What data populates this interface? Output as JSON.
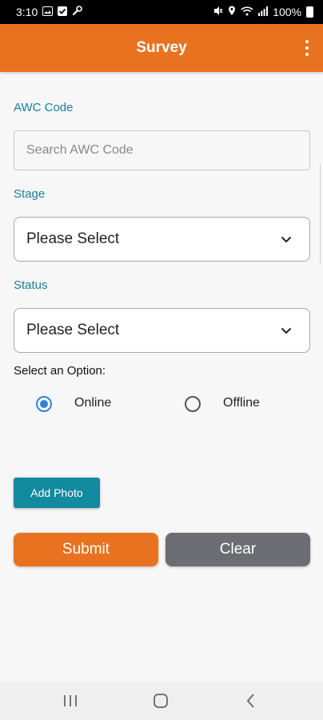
{
  "status_bar": {
    "time": "3:10",
    "battery": "100%",
    "icons": [
      "gallery-icon",
      "checkbox-icon",
      "wrench-icon",
      "mute-icon",
      "location-icon",
      "wifi-icon",
      "signal-icon",
      "battery-icon"
    ]
  },
  "app_bar": {
    "title": "Survey",
    "menu_icon": "more-vert-icon"
  },
  "form": {
    "awc_code": {
      "label": "AWC Code",
      "placeholder": "Search AWC Code",
      "value": ""
    },
    "stage": {
      "label": "Stage",
      "value": "Please Select"
    },
    "status": {
      "label": "Status",
      "value": "Please Select"
    },
    "option": {
      "label": "Select an Option:",
      "choices": [
        "Online",
        "Offline"
      ],
      "selected": "Online"
    },
    "add_photo_label": "Add Photo",
    "submit_label": "Submit",
    "clear_label": "Clear"
  },
  "colors": {
    "primary": "#e8721f",
    "accent": "#17809a",
    "photo_button": "#128aa0",
    "clear_button": "#6c6d73",
    "radio": "#2f84d6"
  },
  "nav_bar": {
    "icons": [
      "recent-apps-icon",
      "home-icon",
      "back-icon"
    ]
  }
}
